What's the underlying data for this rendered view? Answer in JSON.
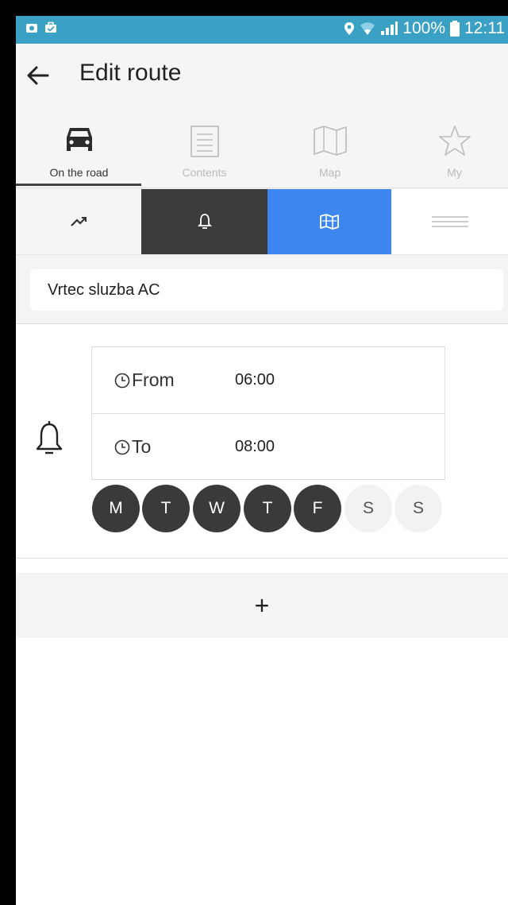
{
  "statusbar": {
    "left_icons": [
      "screenshot-icon",
      "briefcase-icon"
    ],
    "battery": "100%",
    "time": "12:11",
    "color": "#3aa0c4"
  },
  "header": {
    "title": "Edit route",
    "back_icon": "arrow-left-icon"
  },
  "tabs": [
    {
      "label": "On the road",
      "icon": "car-icon",
      "active": true
    },
    {
      "label": "Contents",
      "icon": "list-icon",
      "active": false
    },
    {
      "label": "Map",
      "icon": "map-icon",
      "active": false
    },
    {
      "label": "My",
      "icon": "star-icon",
      "active": false
    }
  ],
  "segments": [
    {
      "icon": "trending-icon",
      "color": "#f5f5f5"
    },
    {
      "icon": "bell-icon",
      "color": "#3b3b3b"
    },
    {
      "icon": "map-icon",
      "color": "#3d86f0"
    },
    {
      "icon": "menu-lines-icon",
      "color": "#ffffff"
    }
  ],
  "route": {
    "name": "Vrtec sluzba AC"
  },
  "alarm": {
    "from_label": "From",
    "from_value": "06:00",
    "to_label": "To",
    "to_value": "08:00",
    "days": [
      {
        "label": "M",
        "on": true
      },
      {
        "label": "T",
        "on": true
      },
      {
        "label": "W",
        "on": true
      },
      {
        "label": "T",
        "on": true
      },
      {
        "label": "F",
        "on": true
      },
      {
        "label": "S",
        "on": false
      },
      {
        "label": "S",
        "on": false
      }
    ]
  },
  "add_button": {
    "label": "+"
  }
}
